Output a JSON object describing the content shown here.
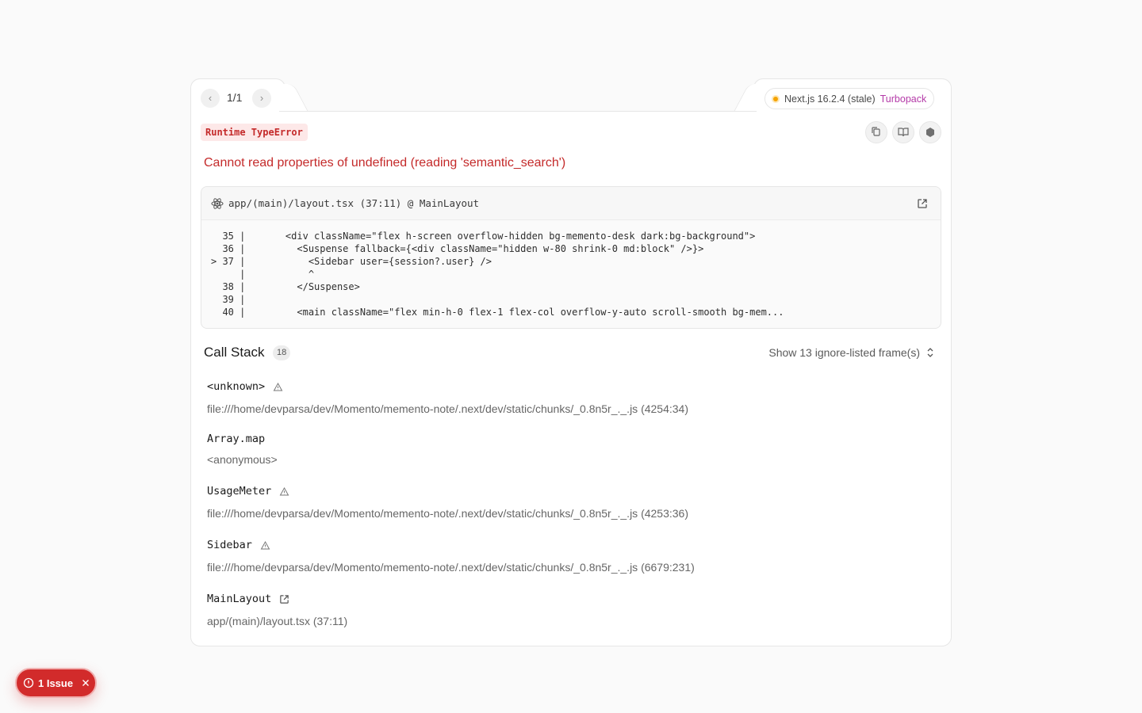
{
  "pager": {
    "count": "1/1"
  },
  "version": {
    "label": "Next.js 16.2.4 (stale)",
    "bundler": "Turbopack"
  },
  "error": {
    "badge": "Runtime TypeError",
    "message": "Cannot read properties of undefined (reading 'semantic_search')"
  },
  "code_frame": {
    "file": "app/(main)/layout.tsx (37:11) @ MainLayout",
    "lines": [
      "  35 |       <div className=\"flex h-screen overflow-hidden bg-memento-desk dark:bg-background\">",
      "  36 |         <Suspense fallback={<div className=\"hidden w-80 shrink-0 md:block\" />}>",
      "> 37 |           <Sidebar user={session?.user} />",
      "     |           ^",
      "  38 |         </Suspense>",
      "  39 |",
      "  40 |         <main className=\"flex min-h-0 flex-1 flex-col overflow-y-auto scroll-smooth bg-mem..."
    ]
  },
  "call_stack": {
    "title": "Call Stack",
    "count": "18",
    "ignore_toggle": "Show 13 ignore-listed frame(s)",
    "frames": [
      {
        "name": "<unknown>",
        "location": "file:///home/devparsa/dev/Momento/memento-note/.next/dev/static/chunks/_0.8n5r_._.js (4254:34)"
      },
      {
        "name": "Array.map",
        "location": "<anonymous>"
      },
      {
        "name": "UsageMeter",
        "location": "file:///home/devparsa/dev/Momento/memento-note/.next/dev/static/chunks/_0.8n5r_._.js (4253:36)"
      },
      {
        "name": "Sidebar",
        "location": "file:///home/devparsa/dev/Momento/memento-note/.next/dev/static/chunks/_0.8n5r_._.js (6679:231)"
      },
      {
        "name": "MainLayout",
        "location": "app/(main)/layout.tsx (37:11)"
      }
    ]
  },
  "issues": {
    "label": "1 Issue"
  },
  "colors": {
    "error": "#c42a2a",
    "turbopack": "#b43aa8",
    "stale_dot": "#f5a300",
    "issue_pill": "#d22b2b"
  }
}
